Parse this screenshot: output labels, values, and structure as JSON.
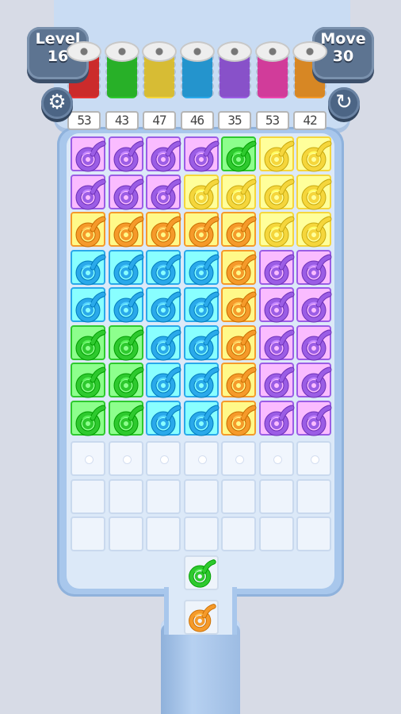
{
  "hud": {
    "level_label": "Level",
    "level_value": "16",
    "move_label": "Move",
    "move_value": "30",
    "settings_icon": "gear-icon",
    "restart_icon": "restart-icon"
  },
  "colors": {
    "purple": "#9b5de5",
    "yellow": "#f5d63c",
    "green": "#2ec92e",
    "orange": "#f59a2a",
    "blue": "#2aa9ea",
    "red": "#e83232",
    "pink": "#ee45b0"
  },
  "spools": [
    {
      "color": "red",
      "count": "53"
    },
    {
      "color": "green",
      "count": "43"
    },
    {
      "color": "yellow",
      "count": "47"
    },
    {
      "color": "blue",
      "count": "46"
    },
    {
      "color": "purple",
      "count": "35"
    },
    {
      "color": "pink",
      "count": "53"
    },
    {
      "color": "orange",
      "count": "42"
    }
  ],
  "grid": {
    "rows": [
      [
        "purple",
        "purple",
        "purple",
        "purple",
        "green",
        "yellow",
        "yellow"
      ],
      [
        "purple",
        "purple",
        "purple",
        "yellow",
        "yellow",
        "yellow",
        "yellow"
      ],
      [
        "orange",
        "orange",
        "orange",
        "orange",
        "orange",
        "yellow",
        "yellow"
      ],
      [
        "blue",
        "blue",
        "blue",
        "blue",
        "orange",
        "purple",
        "purple"
      ],
      [
        "blue",
        "blue",
        "blue",
        "blue",
        "orange",
        "purple",
        "purple"
      ],
      [
        "green",
        "green",
        "blue",
        "blue",
        "orange",
        "purple",
        "purple"
      ],
      [
        "green",
        "green",
        "blue",
        "blue",
        "orange",
        "purple",
        "purple"
      ],
      [
        "green",
        "green",
        "blue",
        "blue",
        "orange",
        "purple",
        "purple"
      ]
    ],
    "empty_rows": 3
  },
  "queue": [
    "green",
    "orange"
  ]
}
